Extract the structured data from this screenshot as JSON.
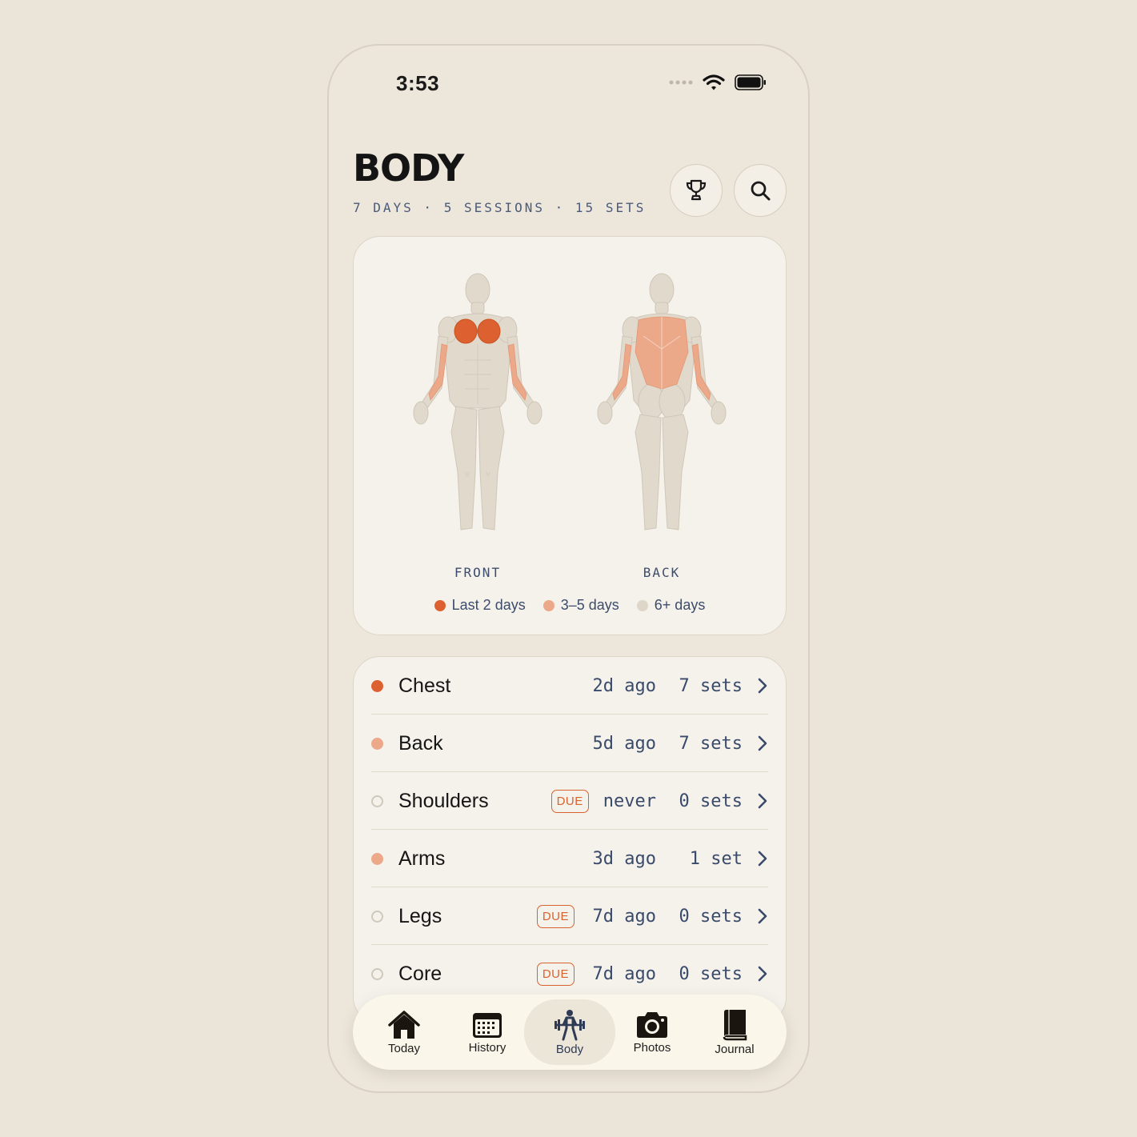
{
  "status": {
    "time": "3:53"
  },
  "header": {
    "title": "BODY",
    "subtitle": "7 DAYS · 5 SESSIONS · 15 SETS"
  },
  "icons": {
    "trophy": "trophy-icon",
    "search": "search-icon"
  },
  "colors": {
    "recent": "#dd6130",
    "mid": "#eca98a",
    "old": "#ddd6c9",
    "accent_text": "#3d4c6b"
  },
  "body_map": {
    "front_label": "FRONT",
    "back_label": "BACK",
    "legend": [
      {
        "label": "Last 2 days",
        "color": "#dd6130"
      },
      {
        "label": "3–5 days",
        "color": "#eca98a"
      },
      {
        "label": "6+ days",
        "color": "#ddd6c9"
      }
    ]
  },
  "muscles": [
    {
      "name": "Chest",
      "due": "",
      "ago": "2d ago",
      "sets": "7 sets",
      "status": "recent"
    },
    {
      "name": "Back",
      "due": "",
      "ago": "5d ago",
      "sets": "7 sets",
      "status": "mid"
    },
    {
      "name": "Shoulders",
      "due": "DUE",
      "ago": "never",
      "sets": "0 sets",
      "status": "none"
    },
    {
      "name": "Arms",
      "due": "",
      "ago": "3d ago",
      "sets": "1 set",
      "status": "mid"
    },
    {
      "name": "Legs",
      "due": "DUE",
      "ago": "7d ago",
      "sets": "0 sets",
      "status": "none"
    },
    {
      "name": "Core",
      "due": "DUE",
      "ago": "7d ago",
      "sets": "0 sets",
      "status": "none"
    }
  ],
  "tabs": [
    {
      "label": "Today",
      "icon": "home-icon",
      "active": false
    },
    {
      "label": "History",
      "icon": "calendar-icon",
      "active": false
    },
    {
      "label": "Body",
      "icon": "weightlifter-icon",
      "active": true
    },
    {
      "label": "Photos",
      "icon": "camera-icon",
      "active": false
    },
    {
      "label": "Journal",
      "icon": "book-icon",
      "active": false
    }
  ]
}
